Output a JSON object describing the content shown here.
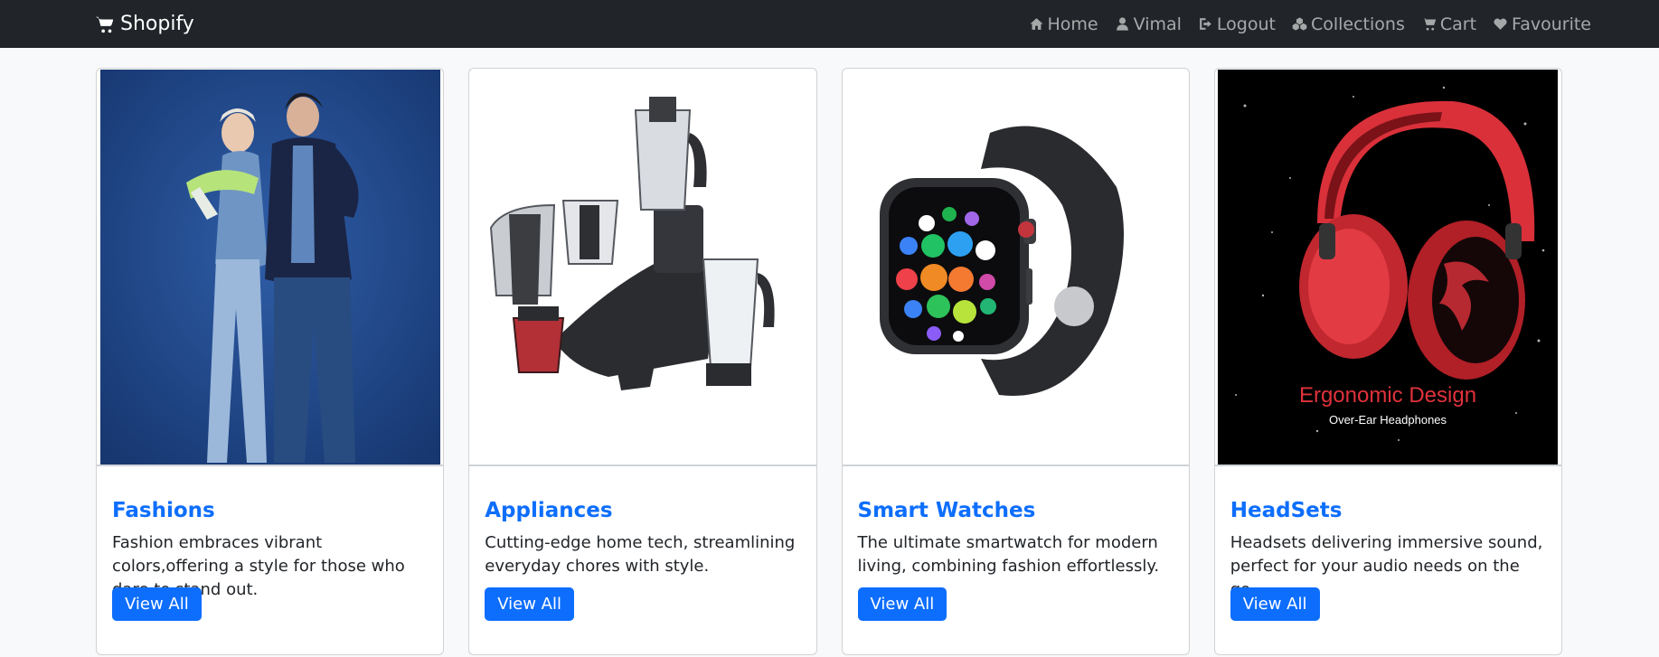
{
  "navbar": {
    "brand": "Shopify",
    "links": [
      {
        "label": "Home",
        "icon": "home-icon"
      },
      {
        "label": "Vimal",
        "icon": "user-icon"
      },
      {
        "label": "Logout",
        "icon": "logout-icon"
      },
      {
        "label": "Collections",
        "icon": "cubes-icon"
      },
      {
        "label": "Cart",
        "icon": "cart-icon"
      },
      {
        "label": "Favourite",
        "icon": "heart-icon"
      }
    ]
  },
  "cards": [
    {
      "title": "Fashions",
      "text": "Fashion embraces vibrant colors,offering a style for those who dare to stand out.",
      "button": "View All",
      "image": "fashion-couple-photo"
    },
    {
      "title": "Appliances",
      "text": "Cutting-edge home tech, streamlining everyday chores with style.",
      "button": "View All",
      "image": "mixer-grinder-photo"
    },
    {
      "title": "Smart Watches",
      "text": "The ultimate smartwatch for modern living, combining fashion effortlessly.",
      "button": "View All",
      "image": "smartwatch-photo"
    },
    {
      "title": "HeadSets",
      "text": "Headsets delivering immersive sound, perfect for your audio needs on the go..",
      "button": "View All",
      "image": "headphones-photo",
      "image_caption": "Ergonomic Design",
      "image_subcaption": "Over-Ear Headphones"
    }
  ],
  "colors": {
    "navbar_bg": "#212529",
    "accent": "#0d6efd",
    "page_bg": "#f8f9fa"
  }
}
